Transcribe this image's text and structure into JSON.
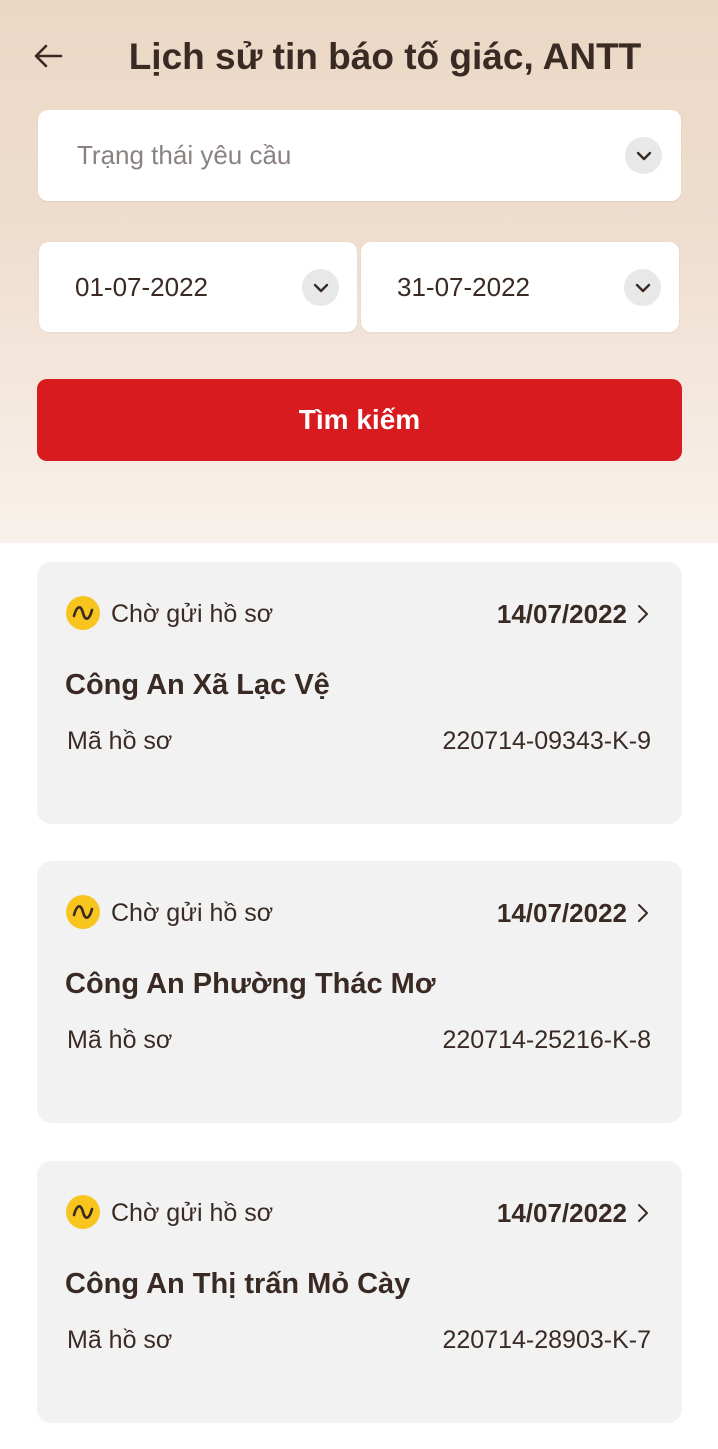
{
  "header": {
    "title": "Lịch sử tin báo tố giác, ANTT",
    "back_icon": "arrow-left-icon"
  },
  "filters": {
    "status_placeholder": "Trạng thái yêu cầu",
    "date_from": "01-07-2022",
    "date_to": "31-07-2022",
    "search_label": "Tìm kiếm"
  },
  "colors": {
    "accent": "#d81b1f",
    "status_pending": "#f7c51e",
    "card_bg": "#f2f2f2"
  },
  "records": [
    {
      "status": "Chờ gửi hồ sơ",
      "date": "14/07/2022",
      "agency": "Công An Xã Lạc Vệ",
      "code_label": "Mã hồ sơ",
      "code": "220714-09343-K-9"
    },
    {
      "status": "Chờ gửi hồ sơ",
      "date": "14/07/2022",
      "agency": "Công An Phường Thác Mơ",
      "code_label": "Mã hồ sơ",
      "code": "220714-25216-K-8"
    },
    {
      "status": "Chờ gửi hồ sơ",
      "date": "14/07/2022",
      "agency": "Công An Thị trấn Mỏ Cày",
      "code_label": "Mã hồ sơ",
      "code": "220714-28903-K-7"
    }
  ]
}
